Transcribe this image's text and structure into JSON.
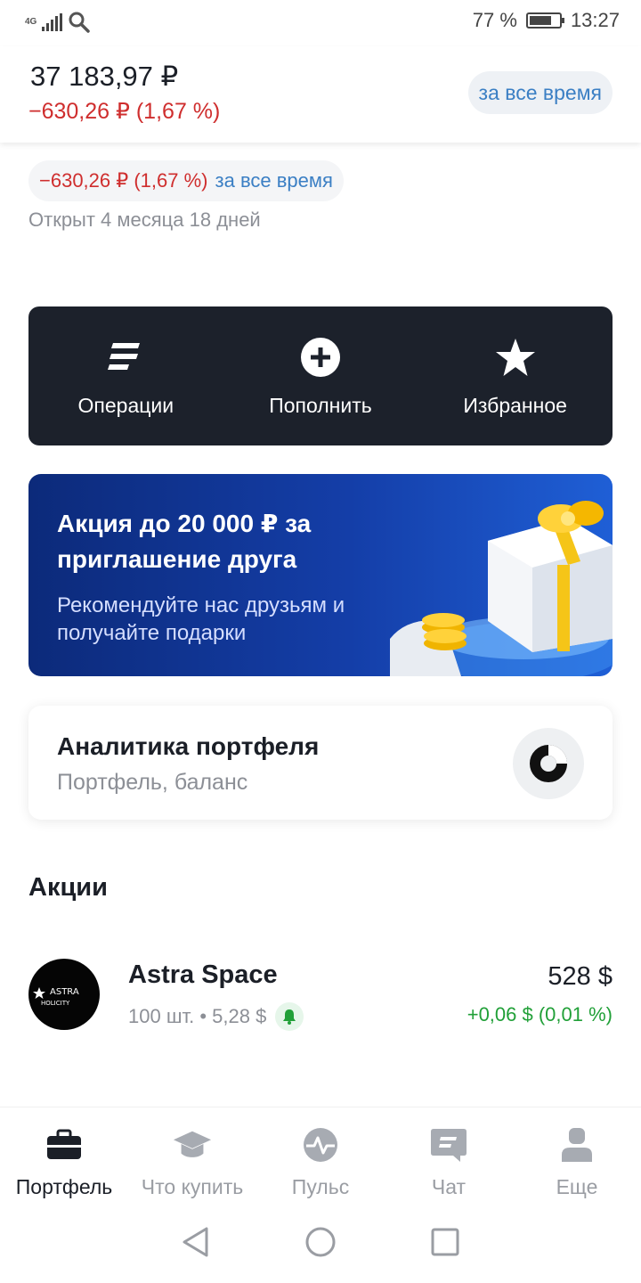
{
  "status_bar": {
    "network": "4G",
    "battery": "77 %",
    "time": "13:27",
    "icons": [
      "signal-icon",
      "search-icon",
      "battery-icon"
    ]
  },
  "header": {
    "amount": "37 183,97  ₽",
    "change": "−630,26 ₽ (1,67 %)",
    "period": "за все время"
  },
  "summary": {
    "change": "−630,26 ₽ (1,67 %)",
    "period": "за все время",
    "opened": "Открыт 4 месяца 18 дней"
  },
  "actions": [
    {
      "label": "Операции",
      "icon": "operations-icon"
    },
    {
      "label": "Пополнить",
      "icon": "plus-circle-icon"
    },
    {
      "label": "Избранное",
      "icon": "star-icon"
    }
  ],
  "promo": {
    "title": "Акция до 20 000 ₽ за приглашение друга",
    "subtitle": "Рекомендуйте нас друзьям и получайте подарки"
  },
  "analytics": {
    "title": "Аналитика портфеля",
    "subtitle": "Портфель, баланс",
    "icon": "donut-chart-icon"
  },
  "section_title": "Акции",
  "stock": {
    "name": "Astra Space",
    "logo_text": "ASTRA",
    "logo_subtext": "HOLICITY",
    "meta": "100 шт. • 5,28 $",
    "value": "528 $",
    "change": "+0,06 $ (0,01 %)"
  },
  "tabs": [
    {
      "label": "Портфель",
      "icon": "briefcase-icon",
      "active": true
    },
    {
      "label": "Что купить",
      "icon": "graduation-cap-icon",
      "active": false
    },
    {
      "label": "Пульс",
      "icon": "pulse-icon",
      "active": false
    },
    {
      "label": "Чат",
      "icon": "chat-icon",
      "active": false
    },
    {
      "label": "Еще",
      "icon": "profile-icon",
      "active": false
    }
  ],
  "colors": {
    "negative": "#cf2e2e",
    "positive": "#21a038",
    "link": "#3b7fc4",
    "dark_card": "#1c212b",
    "promo_blue": "#143ea8"
  }
}
